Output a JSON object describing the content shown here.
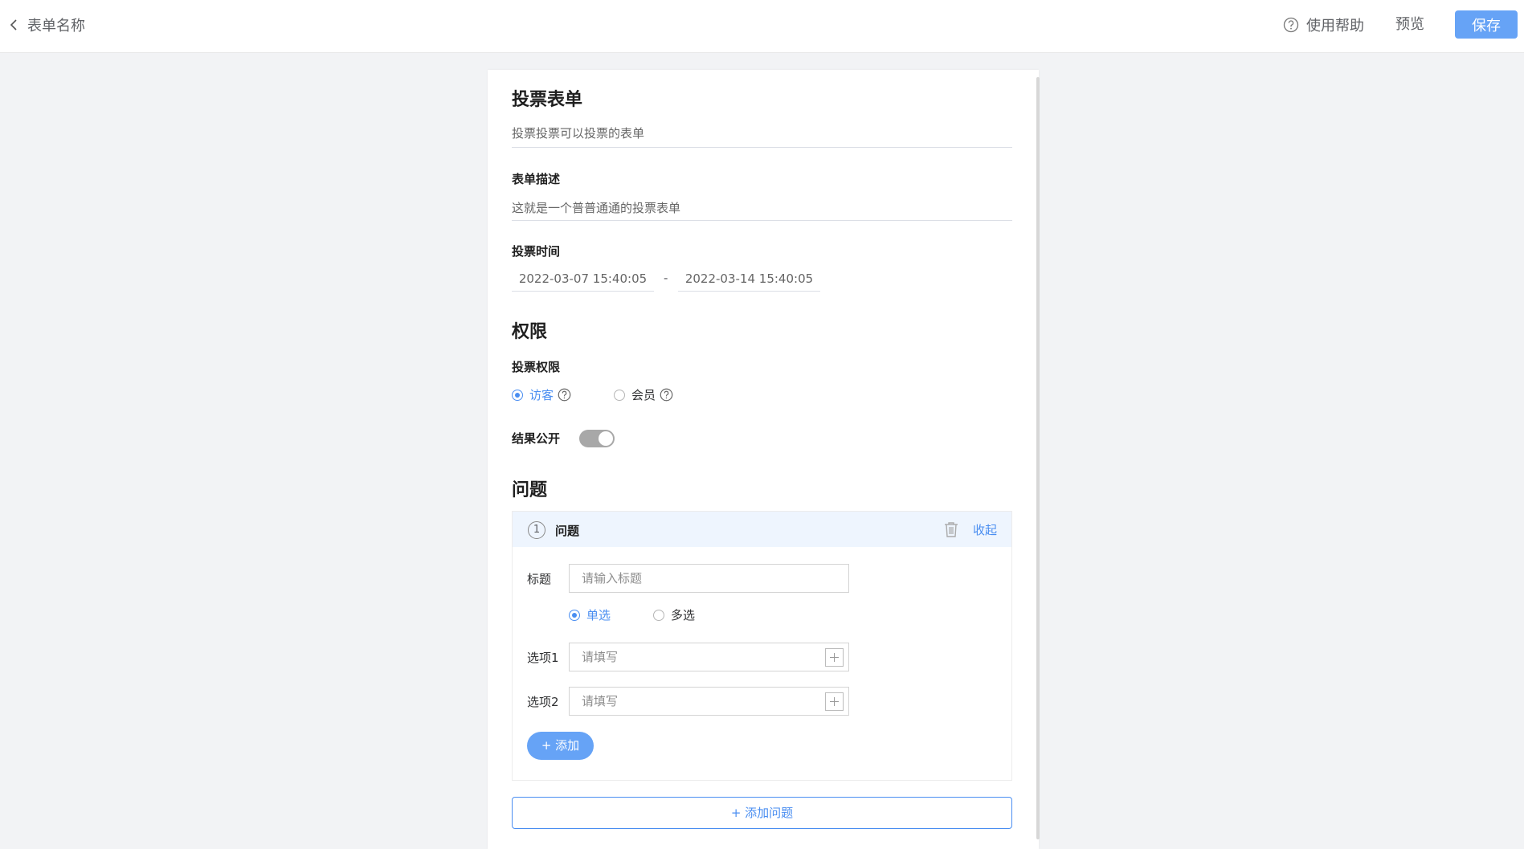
{
  "header": {
    "back_label": "表单名称",
    "help_label": "使用帮助",
    "preview_label": "预览",
    "save_label": "保存"
  },
  "form": {
    "title": "投票表单",
    "subtitle_value": "投票投票可以投票的表单",
    "description_label": "表单描述",
    "description_value": "这就是一个普普通通的投票表单",
    "time_label": "投票时间",
    "start_time": "2022-03-07 15:40:05",
    "separator": "-",
    "end_time": "2022-03-14 15:40:05"
  },
  "permissions": {
    "heading": "权限",
    "vote_permission_label": "投票权限",
    "options": [
      {
        "label": "访客",
        "selected": true
      },
      {
        "label": "会员",
        "selected": false
      }
    ],
    "result_public_label": "结果公开",
    "result_public_on": true
  },
  "questions": {
    "heading": "问题",
    "items": [
      {
        "number": "1",
        "header_title": "问题",
        "collapse_label": "收起",
        "title_label": "标题",
        "title_placeholder": "请输入标题",
        "types": [
          {
            "label": "单选",
            "selected": true
          },
          {
            "label": "多选",
            "selected": false
          }
        ],
        "options": [
          {
            "label": "选项1",
            "placeholder": "请填写"
          },
          {
            "label": "选项2",
            "placeholder": "请填写"
          }
        ],
        "add_label": "+ 添加"
      }
    ],
    "add_question_label": "+ 添加问题"
  },
  "colors": {
    "accent": "#4a8ef1",
    "button": "#66a3f6",
    "background": "#f2f3f5"
  }
}
